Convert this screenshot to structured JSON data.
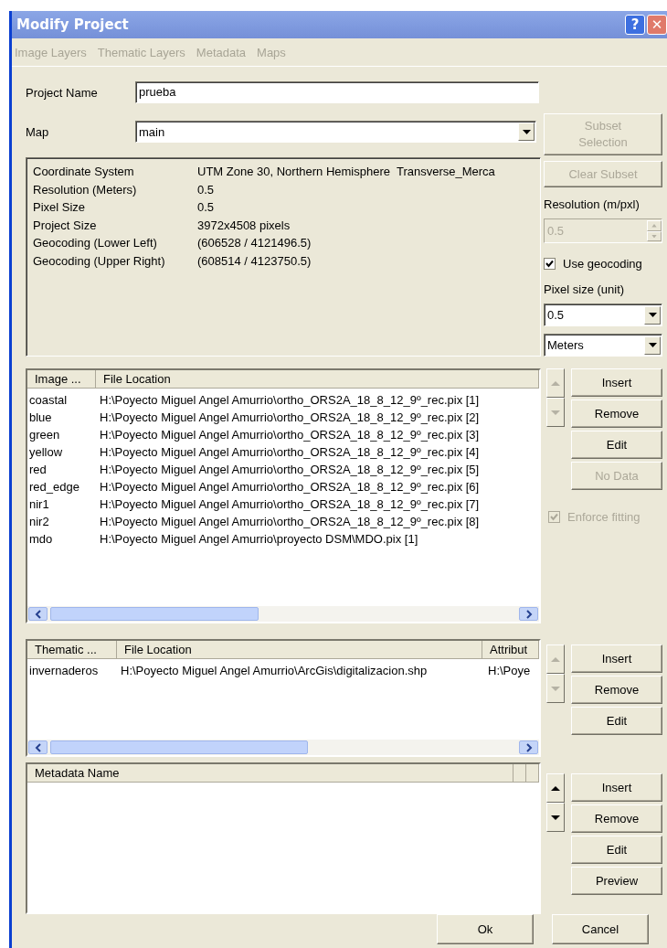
{
  "window": {
    "title": "Modify Project",
    "title_buttons": [
      {
        "kind": "help",
        "label": "?"
      },
      {
        "kind": "close",
        "label": "✕"
      }
    ]
  },
  "menu": [
    {
      "label": "Image Layers",
      "disabled": true
    },
    {
      "label": "Thematic Layers",
      "disabled": true
    },
    {
      "label": "Metadata",
      "disabled": true
    },
    {
      "label": "Maps",
      "disabled": true
    }
  ],
  "project_name": {
    "label": "Project Name",
    "value": "prueba"
  },
  "map": {
    "label": "Map",
    "value": "main"
  },
  "info": [
    {
      "name": "Coordinate System",
      "value": "UTM Zone 30, Northern Hemisphere  Transverse_Merca"
    },
    {
      "name": "Resolution (Meters)",
      "value": "0.5"
    },
    {
      "name": "Pixel Size",
      "value": "0.5"
    },
    {
      "name": "Project Size",
      "value": "3972x4508 pixels"
    },
    {
      "name": "Geocoding (Lower Left)",
      "value": "(606528 / 4121496.5)"
    },
    {
      "name": "Geocoding (Upper Right)",
      "value": "(608514 / 4123750.5)"
    }
  ],
  "subset_selection": {
    "label": "Subset Selection",
    "disabled": true
  },
  "clear_subset": {
    "label": "Clear Subset",
    "disabled": true
  },
  "resolution": {
    "label": "Resolution (m/pxl)",
    "value": "0.5",
    "disabled": true
  },
  "use_geocoding": {
    "label": "Use geocoding",
    "checked": true,
    "disabled": false
  },
  "pixel_size": {
    "label": "Pixel size (unit)",
    "value": "0.5",
    "unit": "Meters"
  },
  "image_layers": {
    "columns": [
      "Image ...",
      "File Location"
    ],
    "rows": [
      [
        "coastal",
        "H:\\Poyecto Miguel Angel Amurrio\\ortho_ORS2A_18_8_12_9º_rec.pix [1]"
      ],
      [
        "blue",
        "H:\\Poyecto Miguel Angel Amurrio\\ortho_ORS2A_18_8_12_9º_rec.pix [2]"
      ],
      [
        "green",
        "H:\\Poyecto Miguel Angel Amurrio\\ortho_ORS2A_18_8_12_9º_rec.pix [3]"
      ],
      [
        "yellow",
        "H:\\Poyecto Miguel Angel Amurrio\\ortho_ORS2A_18_8_12_9º_rec.pix [4]"
      ],
      [
        "red",
        "H:\\Poyecto Miguel Angel Amurrio\\ortho_ORS2A_18_8_12_9º_rec.pix [5]"
      ],
      [
        "red_edge",
        "H:\\Poyecto Miguel Angel Amurrio\\ortho_ORS2A_18_8_12_9º_rec.pix [6]"
      ],
      [
        "nir1",
        "H:\\Poyecto Miguel Angel Amurrio\\ortho_ORS2A_18_8_12_9º_rec.pix [7]"
      ],
      [
        "nir2",
        "H:\\Poyecto Miguel Angel Amurrio\\ortho_ORS2A_18_8_12_9º_rec.pix [8]"
      ],
      [
        "mdo",
        "H:\\Poyecto Miguel Angel Amurrio\\proyecto DSM\\MDO.pix [1]"
      ]
    ],
    "move_up": {
      "disabled": true
    },
    "move_down": {
      "disabled": true
    },
    "buttons": [
      {
        "label": "Insert",
        "disabled": false
      },
      {
        "label": "Remove",
        "disabled": false
      },
      {
        "label": "Edit",
        "disabled": false
      },
      {
        "label": "No Data",
        "disabled": true
      }
    ],
    "enforce_fitting": {
      "label": "Enforce fitting",
      "checked": true,
      "disabled": true
    }
  },
  "thematic_layers": {
    "columns": [
      "Thematic ...",
      "File Location",
      "Attribut"
    ],
    "rows": [
      [
        "invernaderos",
        "H:\\Poyecto Miguel Angel Amurrio\\ArcGis\\digitalizacion.shp",
        "H:\\Poye"
      ]
    ],
    "move_up": {
      "disabled": true
    },
    "move_down": {
      "disabled": true
    },
    "buttons": [
      {
        "label": "Insert",
        "disabled": false
      },
      {
        "label": "Remove",
        "disabled": false
      },
      {
        "label": "Edit",
        "disabled": false
      }
    ]
  },
  "metadata": {
    "columns": [
      "Metadata Name"
    ],
    "move_up": {
      "disabled": false
    },
    "move_down": {
      "disabled": false
    },
    "buttons": [
      {
        "label": "Insert",
        "disabled": false
      },
      {
        "label": "Remove",
        "disabled": false
      },
      {
        "label": "Edit",
        "disabled": false
      },
      {
        "label": "Preview",
        "disabled": false
      }
    ]
  },
  "footer_buttons": [
    "Ok",
    "Cancel"
  ]
}
